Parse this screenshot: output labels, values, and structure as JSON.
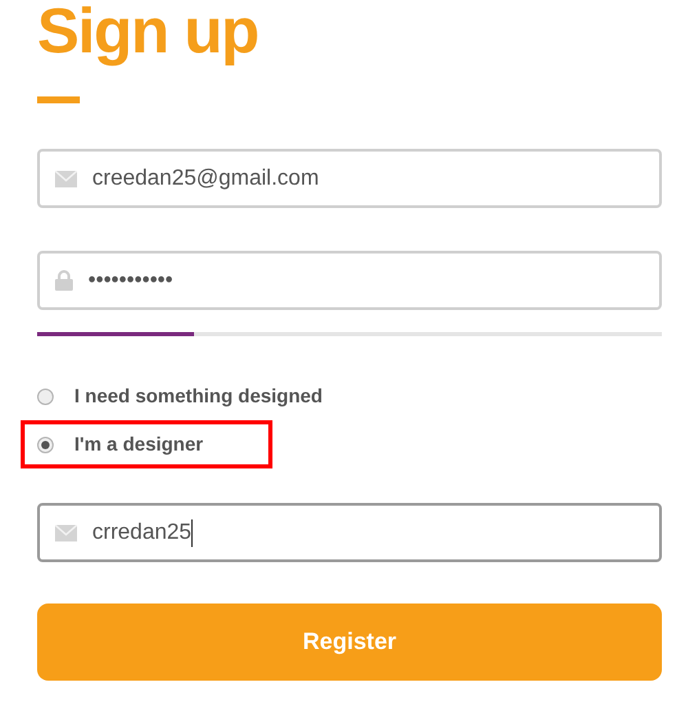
{
  "title": "Sign up",
  "fields": [
    {
      "kind": "email",
      "value": "creedan25@gmail.com",
      "focused": false
    },
    {
      "kind": "password",
      "value": "•••••••••••",
      "focused": false
    }
  ],
  "strength": {
    "level": 0.25
  },
  "roles": [
    {
      "label": "I need something designed",
      "selected": false,
      "highlighted": false
    },
    {
      "label": "I'm a designer",
      "selected": true,
      "highlighted": true
    }
  ],
  "username": {
    "kind": "email",
    "value": "crredan25",
    "focused": true
  },
  "button": "Register"
}
